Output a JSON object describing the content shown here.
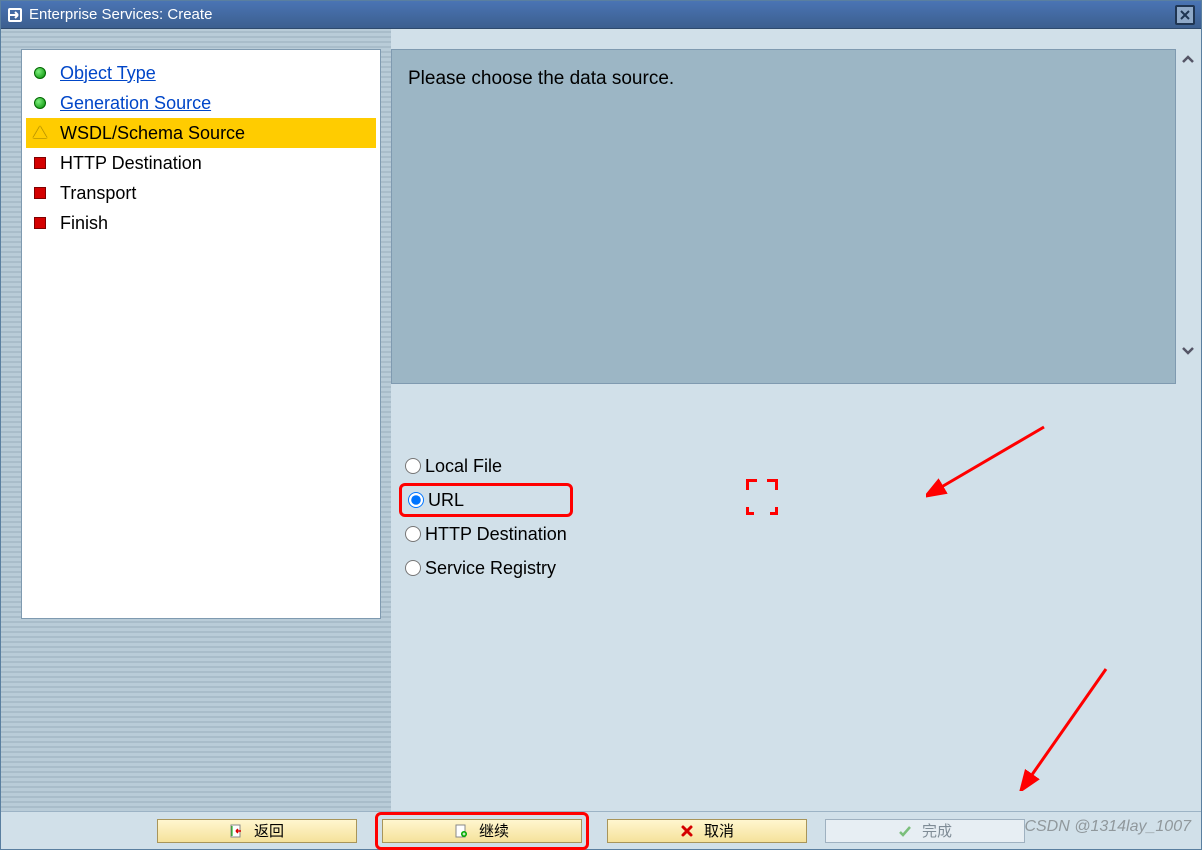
{
  "window": {
    "title": "Enterprise Services: Create"
  },
  "nav": {
    "items": [
      {
        "label": "Object Type",
        "status": "completed"
      },
      {
        "label": "Generation Source",
        "status": "completed"
      },
      {
        "label": "WSDL/Schema Source",
        "status": "current"
      },
      {
        "label": "HTTP Destination",
        "status": "pending"
      },
      {
        "label": "Transport",
        "status": "pending"
      },
      {
        "label": "Finish",
        "status": "pending"
      }
    ]
  },
  "info": {
    "message": "Please choose the data source."
  },
  "source_options": [
    {
      "label": "Local File",
      "selected": false
    },
    {
      "label": "URL",
      "selected": true
    },
    {
      "label": "HTTP Destination",
      "selected": false
    },
    {
      "label": "Service Registry",
      "selected": false
    }
  ],
  "buttons": {
    "back": "返回",
    "continue": "继续",
    "cancel": "取消",
    "finish": "完成"
  },
  "watermark": "CSDN @1314lay_1007"
}
